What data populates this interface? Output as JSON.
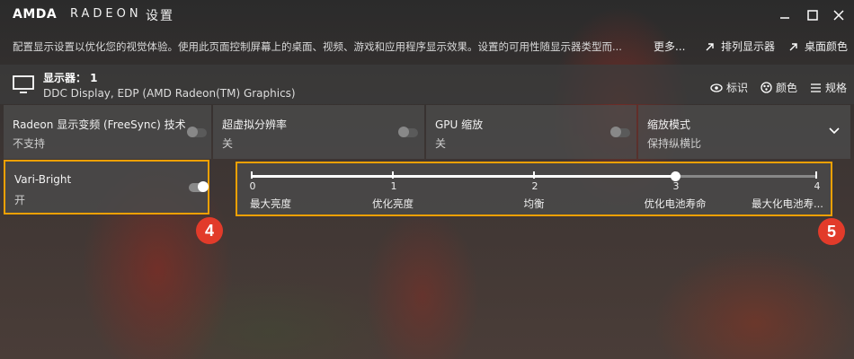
{
  "titlebar": {
    "brand": "AMDA",
    "product": "RADEON",
    "title": "设置"
  },
  "header": {
    "description": "配置显示设置以优化您的视觉体验。使用此页面控制屏幕上的桌面、视频、游戏和应用程序显示效果。设置的可用性随显示器类型而...",
    "more": "更多...",
    "arrange": "排列显示器",
    "desktop_color": "桌面颜色"
  },
  "display": {
    "name": "显示器： 1",
    "subtitle": "DDC Display, EDP (AMD Radeon(TM) Graphics)",
    "identify": "标识",
    "color": "颜色",
    "specs": "规格"
  },
  "tiles": [
    {
      "label": "Radeon 显示变频 (FreeSync) 技术",
      "value": "不支持"
    },
    {
      "label": "超虚拟分辨率",
      "value": "关"
    },
    {
      "label": "GPU 缩放",
      "value": "关"
    },
    {
      "label": "缩放模式",
      "value": "保持纵横比"
    }
  ],
  "vari_bright": {
    "label": "Vari-Bright",
    "value": "开",
    "enabled": true
  },
  "slider": {
    "ticks": [
      "0",
      "1",
      "2",
      "3",
      "4"
    ],
    "labels": [
      "最大亮度",
      "优化亮度",
      "均衡",
      "优化电池寿命",
      "最大化电池寿..."
    ],
    "selected": 3
  },
  "badges": {
    "vb": "4",
    "slider": "5"
  },
  "colors": {
    "highlight": "#f0a000",
    "badge": "#e23b2a"
  }
}
